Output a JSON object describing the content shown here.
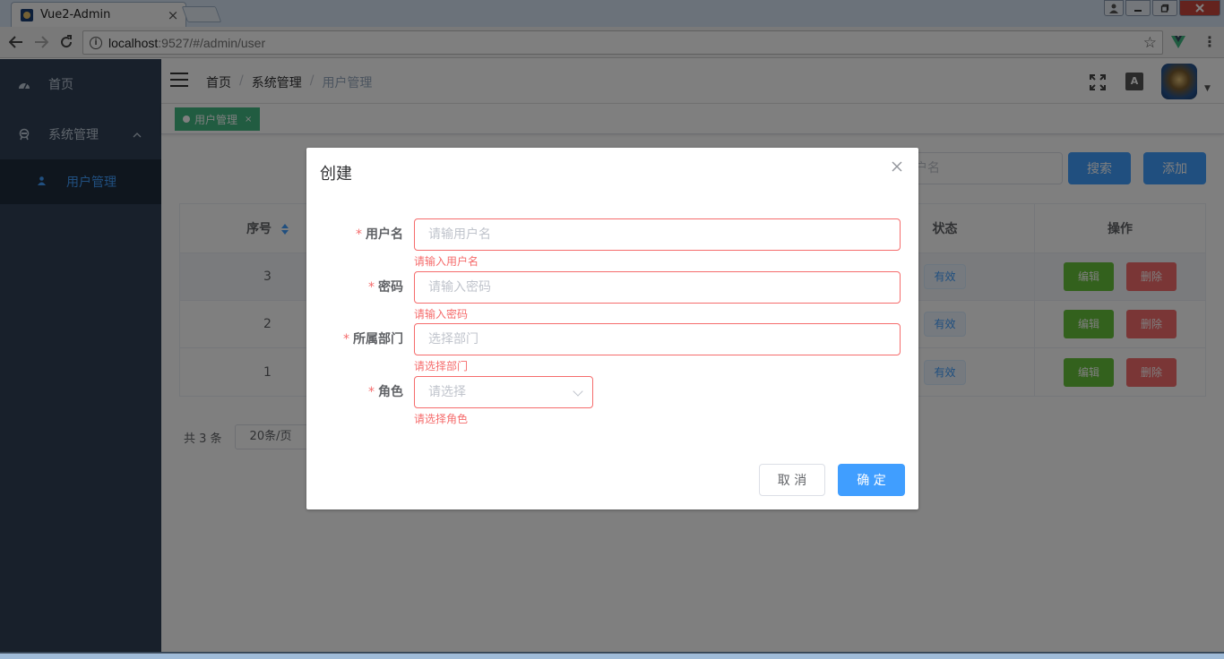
{
  "browser": {
    "tab_title": "Vue2-Admin",
    "tab_close": "×",
    "url_host": "localhost",
    "url_rest": ":9527/#/admin/user"
  },
  "sidebar": {
    "items": [
      {
        "label": "首页",
        "icon": "dashboard-icon"
      },
      {
        "label": "系统管理",
        "icon": "settings-icon",
        "expanded": true
      }
    ],
    "subitems": [
      {
        "label": "用户管理",
        "icon": "user-icon",
        "active": true
      }
    ]
  },
  "navbar": {
    "breadcrumb": [
      "首页",
      "系统管理",
      "用户管理"
    ],
    "separator": "/"
  },
  "tags": [
    {
      "label": "用户管理",
      "close": "×",
      "active": true
    }
  ],
  "toolbar": {
    "search_placeholder_tail": "户名",
    "search_label": "搜索",
    "add_label": "添加"
  },
  "table": {
    "headers": {
      "index": "序号",
      "status": "状态",
      "ops": "操作"
    },
    "rows": [
      {
        "index": "3",
        "status": "有效",
        "edit": "编辑",
        "delete": "删除"
      },
      {
        "index": "2",
        "status": "有效",
        "edit": "编辑",
        "delete": "删除"
      },
      {
        "index": "1",
        "status": "有效",
        "edit": "编辑",
        "delete": "删除"
      }
    ]
  },
  "pager": {
    "total": "共 3 条",
    "page_size": "20条/页"
  },
  "dialog": {
    "title": "创建",
    "close": "×",
    "fields": [
      {
        "label": "用户名",
        "placeholder": "请输用户名",
        "error": "请输入用户名"
      },
      {
        "label": "密码",
        "placeholder": "请输入密码",
        "error": "请输入密码"
      },
      {
        "label": "所属部门",
        "placeholder": "选择部门",
        "error": "请选择部门"
      },
      {
        "label": "角色",
        "placeholder": "请选择",
        "error": "请选择角色"
      }
    ],
    "required_mark": "*",
    "cancel_label": "取 消",
    "confirm_label": "确 定"
  },
  "colors": {
    "primary": "#409eff",
    "success": "#67c23a",
    "danger": "#f56c6c",
    "sidebar_bg": "#304156",
    "tag_bg": "#42b983"
  }
}
